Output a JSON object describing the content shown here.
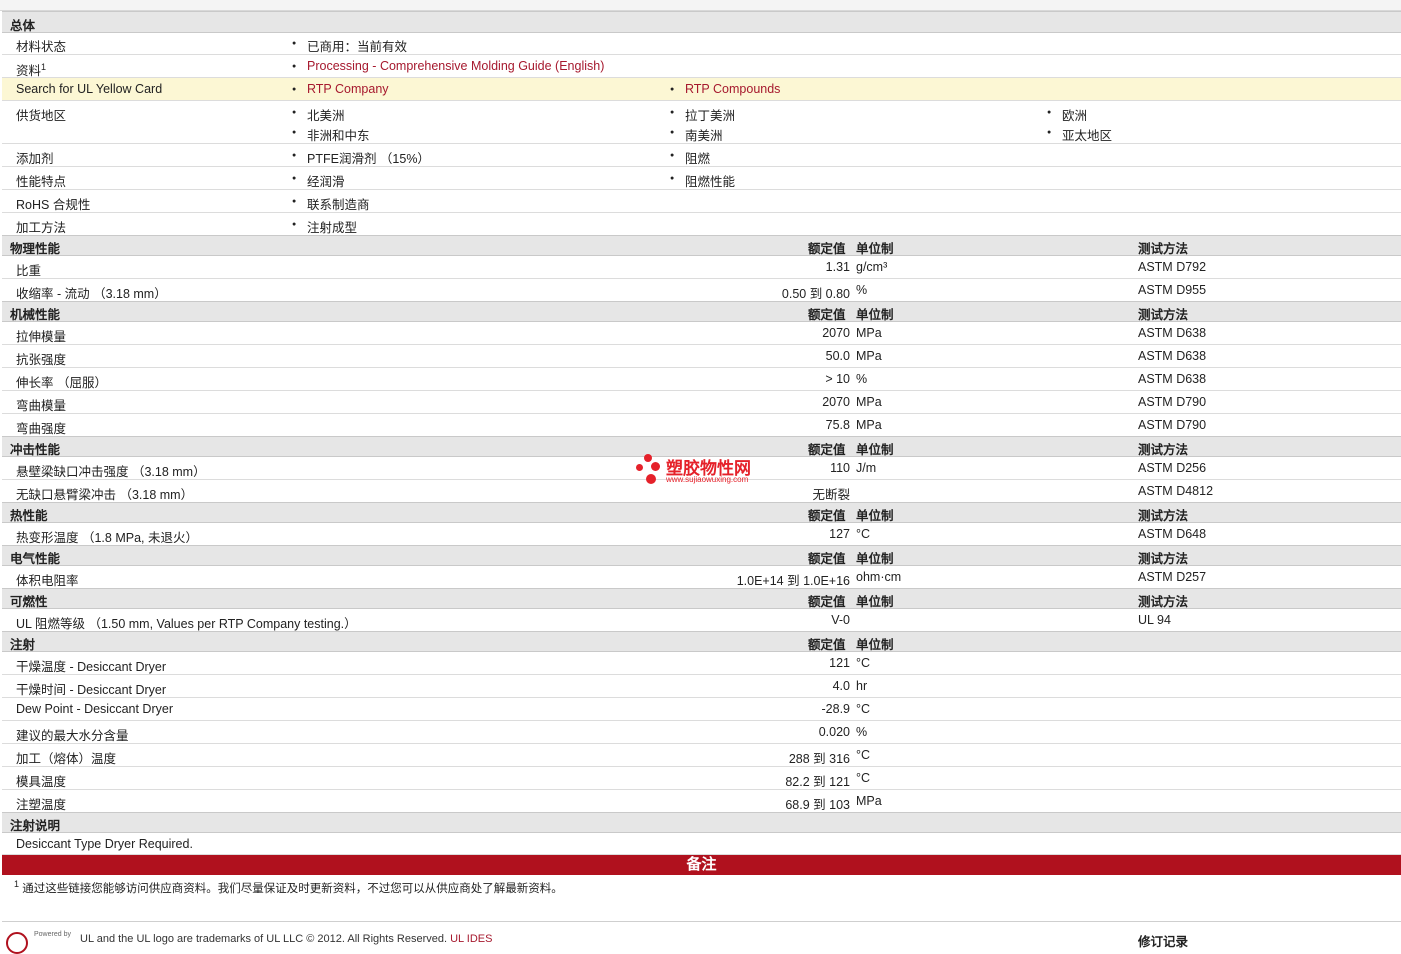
{
  "general": {
    "title": "总体",
    "material_status": {
      "label": "材料状态",
      "value": "已商用：当前有效"
    },
    "literature": {
      "label": "资料",
      "sup": "1",
      "value": "Processing - Comprehensive Molding Guide (English)"
    },
    "ul_card": {
      "label": "Search for UL Yellow Card",
      "v1": "RTP Company",
      "v2": "RTP Compounds"
    },
    "regions": {
      "label": "供货地区",
      "values": [
        "北美洲",
        "拉丁美洲",
        "欧洲",
        "非洲和中东",
        "南美洲",
        "亚太地区"
      ]
    },
    "additive": {
      "label": "添加剂",
      "v1": "PTFE润滑剂 （15%）",
      "v2": "阻燃"
    },
    "features": {
      "label": "性能特点",
      "v1": "经润滑",
      "v2": "阻燃性能"
    },
    "rohs": {
      "label": "RoHS 合规性",
      "value": "联系制造商"
    },
    "processing": {
      "label": "加工方法",
      "value": "注射成型"
    }
  },
  "headers": {
    "nominal": "额定值",
    "unit": "单位制",
    "method": "测试方法"
  },
  "physical": {
    "title": "物理性能",
    "rows": [
      {
        "name": "比重",
        "value": "1.31",
        "unit": "g/cm³",
        "method": "ASTM D792"
      },
      {
        "name": "收缩率  - 流动 （3.18 mm）",
        "value": "0.50 到  0.80",
        "unit": "%",
        "method": "ASTM D955"
      }
    ]
  },
  "mechanical": {
    "title": "机械性能",
    "rows": [
      {
        "name": "拉伸模量",
        "value": "2070",
        "unit": "MPa",
        "method": "ASTM D638"
      },
      {
        "name": "抗张强度",
        "value": "50.0",
        "unit": "MPa",
        "method": "ASTM D638"
      },
      {
        "name": "伸长率 （屈服）",
        "value": "> 10",
        "unit": "%",
        "method": "ASTM D638"
      },
      {
        "name": "弯曲模量",
        "value": "2070",
        "unit": "MPa",
        "method": "ASTM D790"
      },
      {
        "name": "弯曲强度",
        "value": "75.8",
        "unit": "MPa",
        "method": "ASTM D790"
      }
    ]
  },
  "impact": {
    "title": "冲击性能",
    "rows": [
      {
        "name": "悬壁梁缺口冲击强度 （3.18 mm）",
        "value": "110",
        "unit": "J/m",
        "method": "ASTM D256"
      },
      {
        "name": "无缺口悬臂梁冲击 （3.18 mm）",
        "value": "无断裂",
        "unit": "",
        "method": "ASTM D4812"
      }
    ]
  },
  "thermal": {
    "title": "热性能",
    "rows": [
      {
        "name": "热变形温度 （1.8 MPa, 未退火）",
        "value": "127",
        "unit": "°C",
        "method": "ASTM D648"
      }
    ]
  },
  "electrical": {
    "title": "电气性能",
    "rows": [
      {
        "name": "体积电阻率",
        "value": "1.0E+14 到  1.0E+16",
        "unit": "ohm·cm",
        "method": "ASTM D257"
      }
    ]
  },
  "flammability": {
    "title": "可燃性",
    "rows": [
      {
        "name": "UL 阻燃等级 （1.50 mm, Values per RTP Company testing.）",
        "value": "V-0",
        "unit": "",
        "method": "UL 94"
      }
    ]
  },
  "injection": {
    "title": "注射",
    "rows": [
      {
        "name": "干燥温度  - Desiccant Dryer",
        "value": "121",
        "unit": "°C"
      },
      {
        "name": "干燥时间  - Desiccant Dryer",
        "value": "4.0",
        "unit": "hr"
      },
      {
        "name": "Dew Point - Desiccant Dryer",
        "value": "-28.9",
        "unit": "°C"
      },
      {
        "name": "建议的最大水分含量",
        "value": "0.020",
        "unit": "%"
      },
      {
        "name": "加工（熔体）温度",
        "value": "288 到  316",
        "unit": "°C"
      },
      {
        "name": "模具温度",
        "value": "82.2 到  121",
        "unit": "°C"
      },
      {
        "name": "注塑温度",
        "value": "68.9 到  103",
        "unit": "MPa"
      }
    ]
  },
  "injection_notes": {
    "title": "注射说明",
    "text": "Desiccant Type Dryer Required."
  },
  "notes": {
    "banner": "备注",
    "sup": "1",
    "text": "通过这些链接您能够访问供应商资料。我们尽量保证及时更新资料，不过您可以从供应商处了解最新资料。"
  },
  "watermark": {
    "text": "塑胶物性网",
    "url": "www.sujiaowuxing.com"
  },
  "footer": {
    "powered": "Powered by",
    "text": "UL and the UL logo are trademarks of UL LLC © 2012. All Rights Reserved.",
    "link": "UL IDES",
    "revision": "修订记录"
  }
}
